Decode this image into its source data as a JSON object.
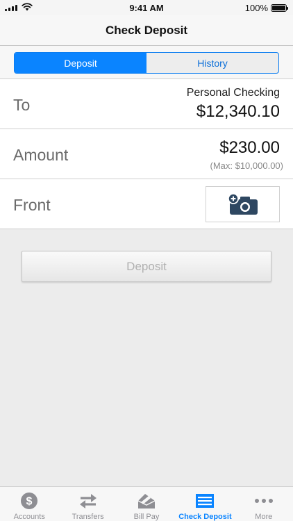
{
  "status_bar": {
    "time": "9:41 AM",
    "battery": "100%"
  },
  "nav": {
    "title": "Check Deposit"
  },
  "segments": [
    {
      "label": "Deposit",
      "active": true
    },
    {
      "label": "History",
      "active": false
    }
  ],
  "form": {
    "to": {
      "label": "To",
      "account": "Personal Checking",
      "balance": "$12,340.10"
    },
    "amount": {
      "label": "Amount",
      "value": "$230.00",
      "max": "(Max: $10,000.00)"
    },
    "front": {
      "label": "Front",
      "icon": "add-camera-icon"
    }
  },
  "deposit_button": {
    "label": "Deposit"
  },
  "tabs": [
    {
      "label": "Accounts",
      "icon": "dollar-circle-icon"
    },
    {
      "label": "Transfers",
      "icon": "transfer-arrows-icon"
    },
    {
      "label": "Bill Pay",
      "icon": "bill-pay-icon"
    },
    {
      "label": "Check Deposit",
      "icon": "check-deposit-icon",
      "active": true
    },
    {
      "label": "More",
      "icon": "more-dots-icon"
    }
  ],
  "colors": {
    "accent": "#0a84ff",
    "icon_dark": "#2e4761",
    "tab_inactive": "#8e8e93"
  }
}
